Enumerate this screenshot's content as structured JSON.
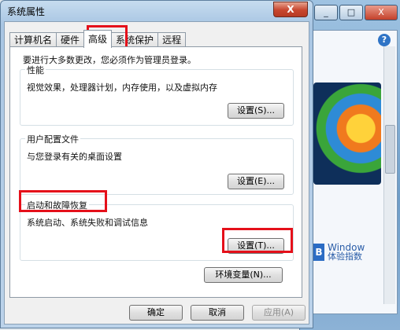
{
  "dialog": {
    "title": "系统属性",
    "close_label": "X",
    "tabs": [
      {
        "label": "计算机名"
      },
      {
        "label": "硬件"
      },
      {
        "label": "高级"
      },
      {
        "label": "系统保护"
      },
      {
        "label": "远程"
      }
    ],
    "active_tab_index": 2,
    "admin_note": "要进行大多数更改，您必须作为管理员登录。",
    "groups": {
      "performance": {
        "title": "性能",
        "desc": "视觉效果，处理器计划，内存使用，以及虚拟内存",
        "button": "设置(S)..."
      },
      "profiles": {
        "title": "用户配置文件",
        "desc": "与您登录有关的桌面设置",
        "button": "设置(E)..."
      },
      "startup": {
        "title": "启动和故障恢复",
        "desc": "系统启动、系统失败和调试信息",
        "button": "设置(T)..."
      }
    },
    "env_button": "环境变量(N)...",
    "footer": {
      "ok": "确定",
      "cancel": "取消",
      "apply": "应用(A)"
    }
  },
  "background_window": {
    "brand_mark": "B",
    "brand_line1": "Window",
    "brand_line2": "体验指数",
    "help_icon": "?",
    "ctrl_min": "_",
    "ctrl_max": "□",
    "ctrl_close": "X"
  },
  "colors": {
    "highlight": "#e5101a"
  }
}
